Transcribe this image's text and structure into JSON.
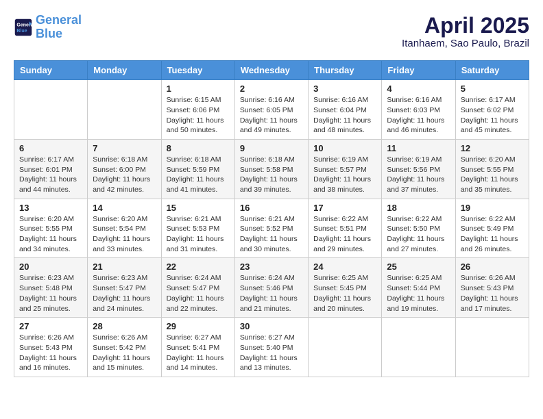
{
  "logo": {
    "line1": "General",
    "line2": "Blue"
  },
  "title": "April 2025",
  "location": "Itanhaem, Sao Paulo, Brazil",
  "days_header": [
    "Sunday",
    "Monday",
    "Tuesday",
    "Wednesday",
    "Thursday",
    "Friday",
    "Saturday"
  ],
  "weeks": [
    [
      {
        "day": "",
        "info": ""
      },
      {
        "day": "",
        "info": ""
      },
      {
        "day": "1",
        "info": "Sunrise: 6:15 AM\nSunset: 6:06 PM\nDaylight: 11 hours\nand 50 minutes."
      },
      {
        "day": "2",
        "info": "Sunrise: 6:16 AM\nSunset: 6:05 PM\nDaylight: 11 hours\nand 49 minutes."
      },
      {
        "day": "3",
        "info": "Sunrise: 6:16 AM\nSunset: 6:04 PM\nDaylight: 11 hours\nand 48 minutes."
      },
      {
        "day": "4",
        "info": "Sunrise: 6:16 AM\nSunset: 6:03 PM\nDaylight: 11 hours\nand 46 minutes."
      },
      {
        "day": "5",
        "info": "Sunrise: 6:17 AM\nSunset: 6:02 PM\nDaylight: 11 hours\nand 45 minutes."
      }
    ],
    [
      {
        "day": "6",
        "info": "Sunrise: 6:17 AM\nSunset: 6:01 PM\nDaylight: 11 hours\nand 44 minutes."
      },
      {
        "day": "7",
        "info": "Sunrise: 6:18 AM\nSunset: 6:00 PM\nDaylight: 11 hours\nand 42 minutes."
      },
      {
        "day": "8",
        "info": "Sunrise: 6:18 AM\nSunset: 5:59 PM\nDaylight: 11 hours\nand 41 minutes."
      },
      {
        "day": "9",
        "info": "Sunrise: 6:18 AM\nSunset: 5:58 PM\nDaylight: 11 hours\nand 39 minutes."
      },
      {
        "day": "10",
        "info": "Sunrise: 6:19 AM\nSunset: 5:57 PM\nDaylight: 11 hours\nand 38 minutes."
      },
      {
        "day": "11",
        "info": "Sunrise: 6:19 AM\nSunset: 5:56 PM\nDaylight: 11 hours\nand 37 minutes."
      },
      {
        "day": "12",
        "info": "Sunrise: 6:20 AM\nSunset: 5:55 PM\nDaylight: 11 hours\nand 35 minutes."
      }
    ],
    [
      {
        "day": "13",
        "info": "Sunrise: 6:20 AM\nSunset: 5:55 PM\nDaylight: 11 hours\nand 34 minutes."
      },
      {
        "day": "14",
        "info": "Sunrise: 6:20 AM\nSunset: 5:54 PM\nDaylight: 11 hours\nand 33 minutes."
      },
      {
        "day": "15",
        "info": "Sunrise: 6:21 AM\nSunset: 5:53 PM\nDaylight: 11 hours\nand 31 minutes."
      },
      {
        "day": "16",
        "info": "Sunrise: 6:21 AM\nSunset: 5:52 PM\nDaylight: 11 hours\nand 30 minutes."
      },
      {
        "day": "17",
        "info": "Sunrise: 6:22 AM\nSunset: 5:51 PM\nDaylight: 11 hours\nand 29 minutes."
      },
      {
        "day": "18",
        "info": "Sunrise: 6:22 AM\nSunset: 5:50 PM\nDaylight: 11 hours\nand 27 minutes."
      },
      {
        "day": "19",
        "info": "Sunrise: 6:22 AM\nSunset: 5:49 PM\nDaylight: 11 hours\nand 26 minutes."
      }
    ],
    [
      {
        "day": "20",
        "info": "Sunrise: 6:23 AM\nSunset: 5:48 PM\nDaylight: 11 hours\nand 25 minutes."
      },
      {
        "day": "21",
        "info": "Sunrise: 6:23 AM\nSunset: 5:47 PM\nDaylight: 11 hours\nand 24 minutes."
      },
      {
        "day": "22",
        "info": "Sunrise: 6:24 AM\nSunset: 5:47 PM\nDaylight: 11 hours\nand 22 minutes."
      },
      {
        "day": "23",
        "info": "Sunrise: 6:24 AM\nSunset: 5:46 PM\nDaylight: 11 hours\nand 21 minutes."
      },
      {
        "day": "24",
        "info": "Sunrise: 6:25 AM\nSunset: 5:45 PM\nDaylight: 11 hours\nand 20 minutes."
      },
      {
        "day": "25",
        "info": "Sunrise: 6:25 AM\nSunset: 5:44 PM\nDaylight: 11 hours\nand 19 minutes."
      },
      {
        "day": "26",
        "info": "Sunrise: 6:26 AM\nSunset: 5:43 PM\nDaylight: 11 hours\nand 17 minutes."
      }
    ],
    [
      {
        "day": "27",
        "info": "Sunrise: 6:26 AM\nSunset: 5:43 PM\nDaylight: 11 hours\nand 16 minutes."
      },
      {
        "day": "28",
        "info": "Sunrise: 6:26 AM\nSunset: 5:42 PM\nDaylight: 11 hours\nand 15 minutes."
      },
      {
        "day": "29",
        "info": "Sunrise: 6:27 AM\nSunset: 5:41 PM\nDaylight: 11 hours\nand 14 minutes."
      },
      {
        "day": "30",
        "info": "Sunrise: 6:27 AM\nSunset: 5:40 PM\nDaylight: 11 hours\nand 13 minutes."
      },
      {
        "day": "",
        "info": ""
      },
      {
        "day": "",
        "info": ""
      },
      {
        "day": "",
        "info": ""
      }
    ]
  ]
}
